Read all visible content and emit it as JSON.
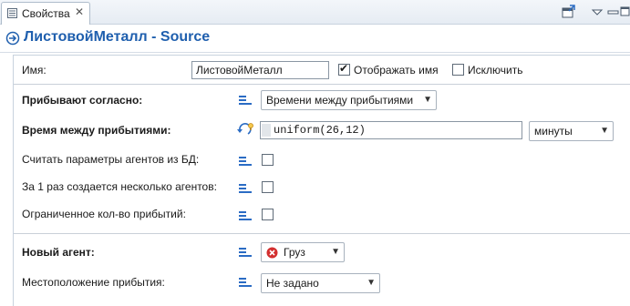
{
  "tab": {
    "title": "Свойства",
    "close_glyph": "✕"
  },
  "toolbar": {
    "icons": [
      "pin-view-icon",
      "view-menu-icon",
      "minimize-icon",
      "maximize-icon"
    ]
  },
  "header": {
    "title": "ЛистовойМеталл - Source",
    "icon": "block-source-icon"
  },
  "props": {
    "name": {
      "label": "Имя:",
      "value": "ЛистовойМеталл"
    },
    "show_name": {
      "label": "Отображать имя",
      "checked": true
    },
    "exclude": {
      "label": "Исключить",
      "checked": false
    },
    "arrivals_according": {
      "label": "Прибывают согласно:",
      "value": "Времени между прибытиями"
    },
    "interarrival_time": {
      "label": "Время между прибытиями:",
      "value": "uniform(26,12)",
      "unit": "минуты"
    },
    "read_from_db": {
      "label": "Считать параметры агентов из БД:",
      "checked": false
    },
    "multiple_per_arrival": {
      "label": "За 1 раз создается несколько агентов:",
      "checked": false
    },
    "limited_arrivals": {
      "label": "Ограниченное кол-во прибытий:",
      "checked": false
    },
    "new_agent": {
      "label": "Новый агент:",
      "value": "Груз"
    },
    "arrival_location": {
      "label": "Местоположение прибытия:",
      "value": "Не задано"
    }
  },
  "colors": {
    "title_blue": "#1f5fae",
    "eq_icon_blue": "#2b6cc4",
    "error_red": "#d32f2f"
  }
}
